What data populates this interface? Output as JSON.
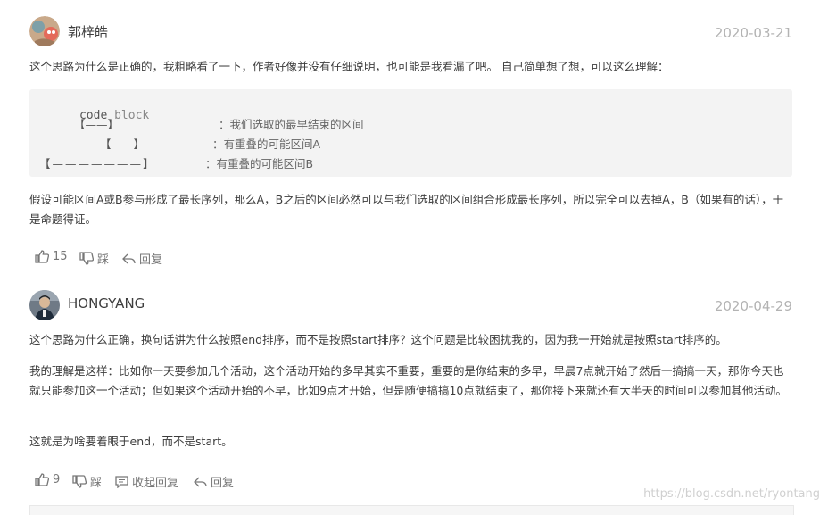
{
  "comments": [
    {
      "user": "郭梓皓",
      "date": "2020-03-21",
      "intro": "这个思路为什么是正确的，我粗略看了一下，作者好像并没有仔细说明，也可能是我看漏了吧。 自己简单想了想，可以这么理解：",
      "code": {
        "header_word1": "code",
        "header_word2": "block",
        "rows": [
          {
            "bracket": "【——】",
            "note": "：我们选取的最早结束的区间"
          },
          {
            "bracket": "【——】",
            "note": "：有重叠的可能区间A"
          },
          {
            "bracket": "【———————】",
            "note": "：有重叠的可能区间B"
          }
        ]
      },
      "body": "假设可能区间A或B参与形成了最长序列，那么A，B之后的区间必然可以与我们选取的区间组合形成最长序列，所以完全可以去掉A，B（如果有的话），于是命题得证。",
      "likes": "15",
      "dislike_label": "踩",
      "reply_label": "回复"
    },
    {
      "user": "HONGYANG",
      "date": "2020-04-29",
      "para1": "这个思路为什么正确，换句话讲为什么按照end排序，而不是按照start排序？这个问题是比较困扰我的，因为我一开始就是按照start排序的。",
      "para2": "我的理解是这样：比如你一天要参加几个活动，这个活动开始的多早其实不重要，重要的是你结束的多早，早晨7点就开始了然后一搞搞一天，那你今天也就只能参加这一个活动；但如果这个活动开始的不早，比如9点才开始，但是随便搞搞10点就结束了，那你接下来就还有大半天的时间可以参加其他活动。",
      "para3": "这就是为啥要着眼于end，而不是start。",
      "likes": "9",
      "dislike_label": "踩",
      "collapse_label": "收起回复",
      "reply_label": "回复"
    }
  ],
  "watermark": "https://blog.csdn.net/ryontang",
  "icons": [
    "thumb-up-icon",
    "thumb-down-icon",
    "reply-arrow-icon",
    "comment-icon"
  ]
}
